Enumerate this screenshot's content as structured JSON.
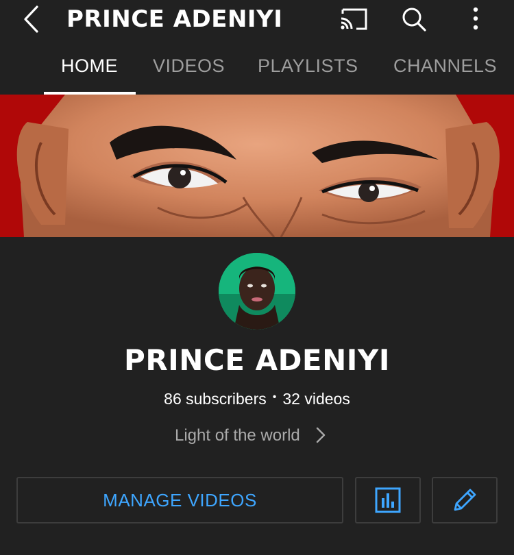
{
  "header": {
    "title": "PRINCE ADENIYI",
    "back_icon": "chevron-left-icon",
    "cast_icon": "cast-icon",
    "search_icon": "search-icon",
    "more_icon": "more-vertical-icon"
  },
  "tabs": [
    {
      "label": "HOME",
      "active": true
    },
    {
      "label": "VIDEOS",
      "active": false
    },
    {
      "label": "PLAYLISTS",
      "active": false
    },
    {
      "label": "CHANNELS",
      "active": false
    }
  ],
  "channel": {
    "name": "PRINCE ADENIYI",
    "subscribers": "86 subscribers",
    "separator": "•",
    "videos": "32 videos",
    "tagline": "Light of the world"
  },
  "actions": {
    "manage_videos": "MANAGE VIDEOS",
    "analytics_icon": "analytics-icon",
    "edit_icon": "pencil-icon"
  },
  "colors": {
    "background": "#212121",
    "accent": "#3ea6ff",
    "banner_red": "#b00808",
    "avatar_bg": "#16b57c"
  }
}
